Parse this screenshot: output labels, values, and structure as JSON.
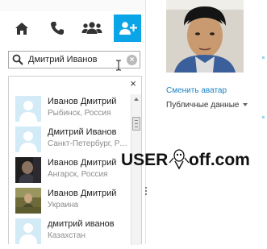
{
  "tabs": [
    {
      "name": "home",
      "icon": "home-icon"
    },
    {
      "name": "calls",
      "icon": "phone-icon"
    },
    {
      "name": "contacts",
      "icon": "group-icon"
    },
    {
      "name": "add-contact",
      "icon": "add-contact-icon",
      "active": true
    }
  ],
  "search": {
    "value": "Дмитрий Иванов",
    "clear_glyph": "×"
  },
  "results": {
    "close_glyph": "×",
    "contacts": [
      {
        "name": "Иванов Дмитрий",
        "location": "Рыбинск, Россия",
        "avatar": "default"
      },
      {
        "name": "Дмитрий Иванов",
        "location": "Санкт-Петербург, Россия",
        "avatar": "default"
      },
      {
        "name": "Иванов Дмитрий",
        "location": "Ангарск, Россия",
        "avatar": "photo-dark"
      },
      {
        "name": "Иванов Дмитрий",
        "location": "Украина",
        "avatar": "photo-outdoor"
      },
      {
        "name": "дмитрий иванов",
        "location": "Казахстан",
        "avatar": "default"
      }
    ]
  },
  "profile": {
    "change_avatar": "Сменить аватар",
    "public_data": "Публичные данные"
  },
  "watermark": {
    "text_a": "USER",
    "text_b": "off.com"
  },
  "colors": {
    "accent": "#0aa5e6",
    "link": "#1a82c4",
    "default_avatar": "#d3eaf7"
  }
}
